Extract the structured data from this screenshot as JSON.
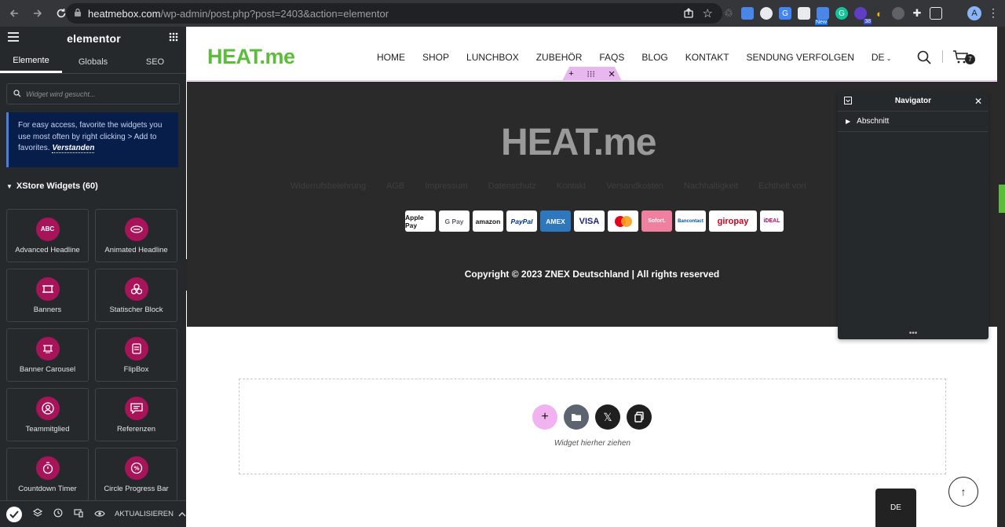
{
  "browser": {
    "url_host": "heatmebox.com",
    "url_path": "/wp-admin/post.php?post=2403&action=elementor",
    "profile_initial": "A",
    "ext_badge_new": "New",
    "ext_badge_count": "38"
  },
  "panel": {
    "logo": "elementor",
    "tabs": [
      "Elemente",
      "Globals",
      "SEO"
    ],
    "search_placeholder": "Widget wird gesucht...",
    "tip_text": "For easy access, favorite the widgets you use most often by right clicking > Add to favorites.",
    "tip_link": "Verstanden",
    "category_title": "XStore Widgets (60)",
    "widgets": [
      {
        "label": "Advanced Headline",
        "icon": "abc-icon"
      },
      {
        "label": "Animated Headline",
        "icon": "animated-headline-icon"
      },
      {
        "label": "Banners",
        "icon": "banner-icon"
      },
      {
        "label": "Statischer Block",
        "icon": "blocks-icon"
      },
      {
        "label": "Banner Carousel",
        "icon": "banner-carousel-icon"
      },
      {
        "label": "FlipBox",
        "icon": "flipbox-icon"
      },
      {
        "label": "Teammitglied",
        "icon": "team-member-icon"
      },
      {
        "label": "Referenzen",
        "icon": "testimonial-icon"
      },
      {
        "label": "Countdown Timer",
        "icon": "countdown-icon"
      },
      {
        "label": "Circle Progress Bar",
        "icon": "circle-progress-icon"
      }
    ],
    "update_label": "AKTUALISIEREN"
  },
  "site": {
    "logo": "HEAT.me",
    "menu": [
      "HOME",
      "SHOP",
      "LUNCHBOX",
      "ZUBEHÖR",
      "FAQS",
      "BLOG",
      "KONTAKT",
      "SENDUNG VERFOLGEN",
      "DE"
    ],
    "cart_count": "7",
    "footer_logo": "HEAT.me",
    "footer_links": [
      "Widerrufsbelehrung",
      "AGB",
      "Impressum",
      "Datenschutz",
      "Kontakt",
      "Versandkosten",
      "Nachhaltigkeit",
      "Echtheit von"
    ],
    "payments": [
      "Apple Pay",
      "G Pay",
      "amazon",
      "PayPal",
      "AMEX",
      "VISA",
      "MC",
      "Sofort.",
      "Bancontact",
      "giropay",
      "iDEAL"
    ],
    "copyright": "Copyright © 2023 ZNEX Deutschland | All rights reserved",
    "lang_tab": "DE"
  },
  "navigator": {
    "title": "Navigator",
    "row_label": "Abschnitt"
  },
  "dropzone": {
    "text": "Widget hierher ziehen"
  },
  "colors": {
    "accent_pink": "#e8b7f0",
    "widget_icon": "#a8145a",
    "brand_green": "#5bbd3a",
    "footer_bg": "#2b2a2b",
    "panel_bg": "#26292c"
  }
}
